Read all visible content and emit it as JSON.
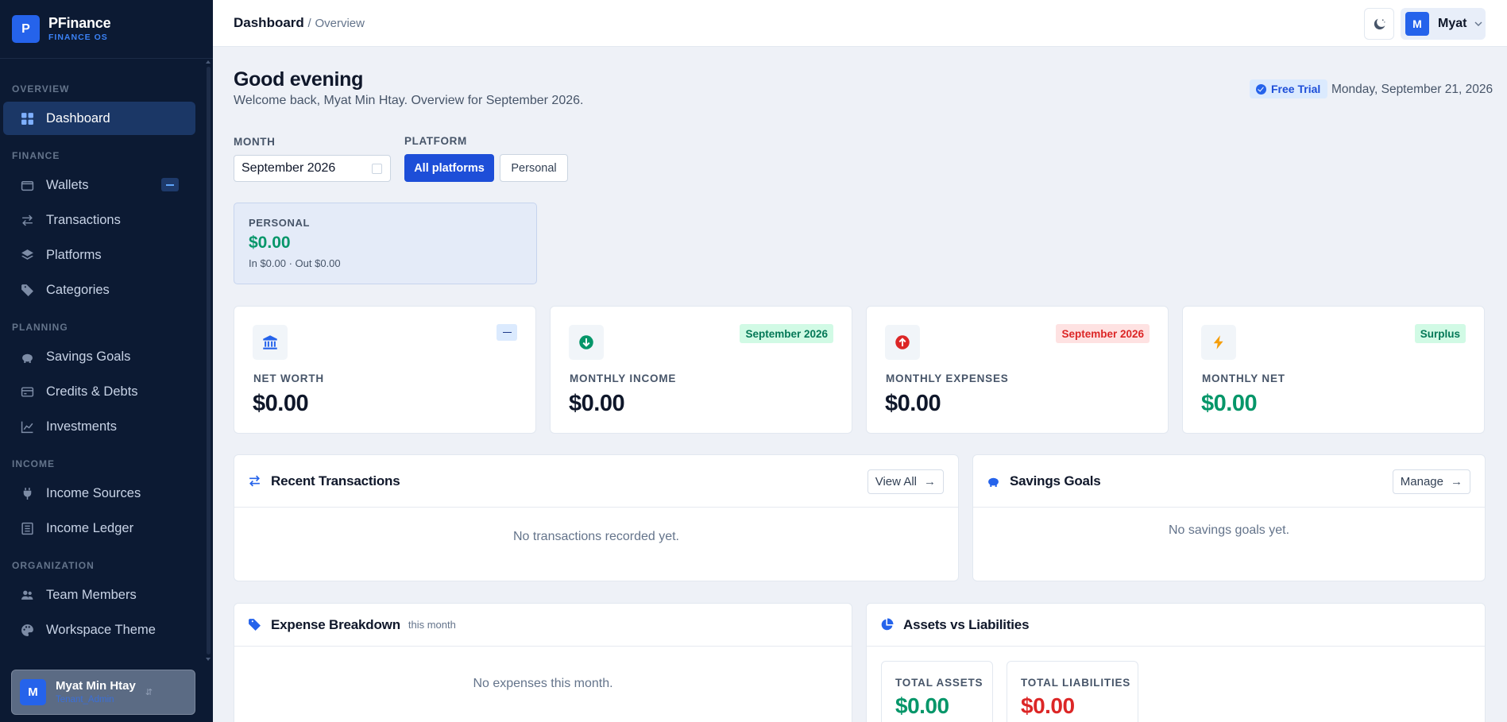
{
  "brand": {
    "logo_letter": "P",
    "name": "PFinance",
    "subtitle": "FINANCE OS"
  },
  "sidebar": {
    "sections": {
      "overview": "OVERVIEW",
      "finance": "FINANCE",
      "planning": "PLANNING",
      "income": "INCOME",
      "organization": "ORGANIZATION"
    },
    "items": {
      "dashboard": "Dashboard",
      "wallets": "Wallets",
      "transactions": "Transactions",
      "platforms": "Platforms",
      "categories": "Categories",
      "savings_goals": "Savings Goals",
      "credits_debts": "Credits & Debts",
      "investments": "Investments",
      "income_sources": "Income Sources",
      "income_ledger": "Income Ledger",
      "team_members": "Team Members",
      "workspace_theme": "Workspace Theme"
    },
    "active": "dashboard",
    "user": {
      "avatar_letter": "M",
      "name": "Myat Min Htay",
      "role": "Tenant_Admin"
    }
  },
  "topbar": {
    "breadcrumb_main": "Dashboard",
    "breadcrumb_sep": "/",
    "breadcrumb_sub": "Overview",
    "profile": {
      "avatar_letter": "M",
      "name": "Myat"
    }
  },
  "header": {
    "greeting": "Good evening",
    "subtitle": "Welcome back, Myat Min Htay. Overview for September 2026.",
    "trial_badge": "Free Trial",
    "date": "Monday, September 21, 2026"
  },
  "filters": {
    "month_label": "MONTH",
    "month_value": "September 2026",
    "platform_label": "PLATFORM",
    "platform_options": [
      "All platforms",
      "Personal"
    ],
    "platform_selected": "All platforms"
  },
  "personal_card": {
    "title": "PERSONAL",
    "value": "$0.00",
    "summary": "In $0.00 · Out $0.00"
  },
  "stats": [
    {
      "title": "NET WORTH",
      "value": "$0.00",
      "badge": "",
      "icon": "bank-icon",
      "color": "#2563eb"
    },
    {
      "title": "MONTHLY INCOME",
      "value": "$0.00",
      "badge": "September 2026",
      "icon": "arrow-down-circle-icon",
      "color": "#059669"
    },
    {
      "title": "MONTHLY EXPENSES",
      "value": "$0.00",
      "badge": "September 2026",
      "icon": "arrow-up-circle-icon",
      "color": "#dc2626"
    },
    {
      "title": "MONTHLY NET",
      "value": "$0.00",
      "badge": "Surplus",
      "icon": "lightning-icon",
      "color": "#f59e0b"
    }
  ],
  "panels": {
    "recent_transactions": {
      "title": "Recent Transactions",
      "action": "View All",
      "empty": "No transactions recorded yet."
    },
    "savings_goals": {
      "title": "Savings Goals",
      "action": "Manage",
      "empty": "No savings goals yet."
    },
    "expense_breakdown": {
      "title": "Expense Breakdown",
      "subtitle": "this month",
      "empty": "No expenses this month."
    },
    "assets_liabilities": {
      "title": "Assets vs Liabilities",
      "total_assets_label": "TOTAL ASSETS",
      "total_assets_value": "$0.00",
      "total_liabilities_label": "TOTAL LIABILITIES",
      "total_liabilities_value": "$0.00"
    }
  },
  "colors": {
    "accent": "#1d4ed8",
    "positive": "#059669",
    "negative": "#dc2626",
    "sidebar_bg": "#0c1a33"
  }
}
